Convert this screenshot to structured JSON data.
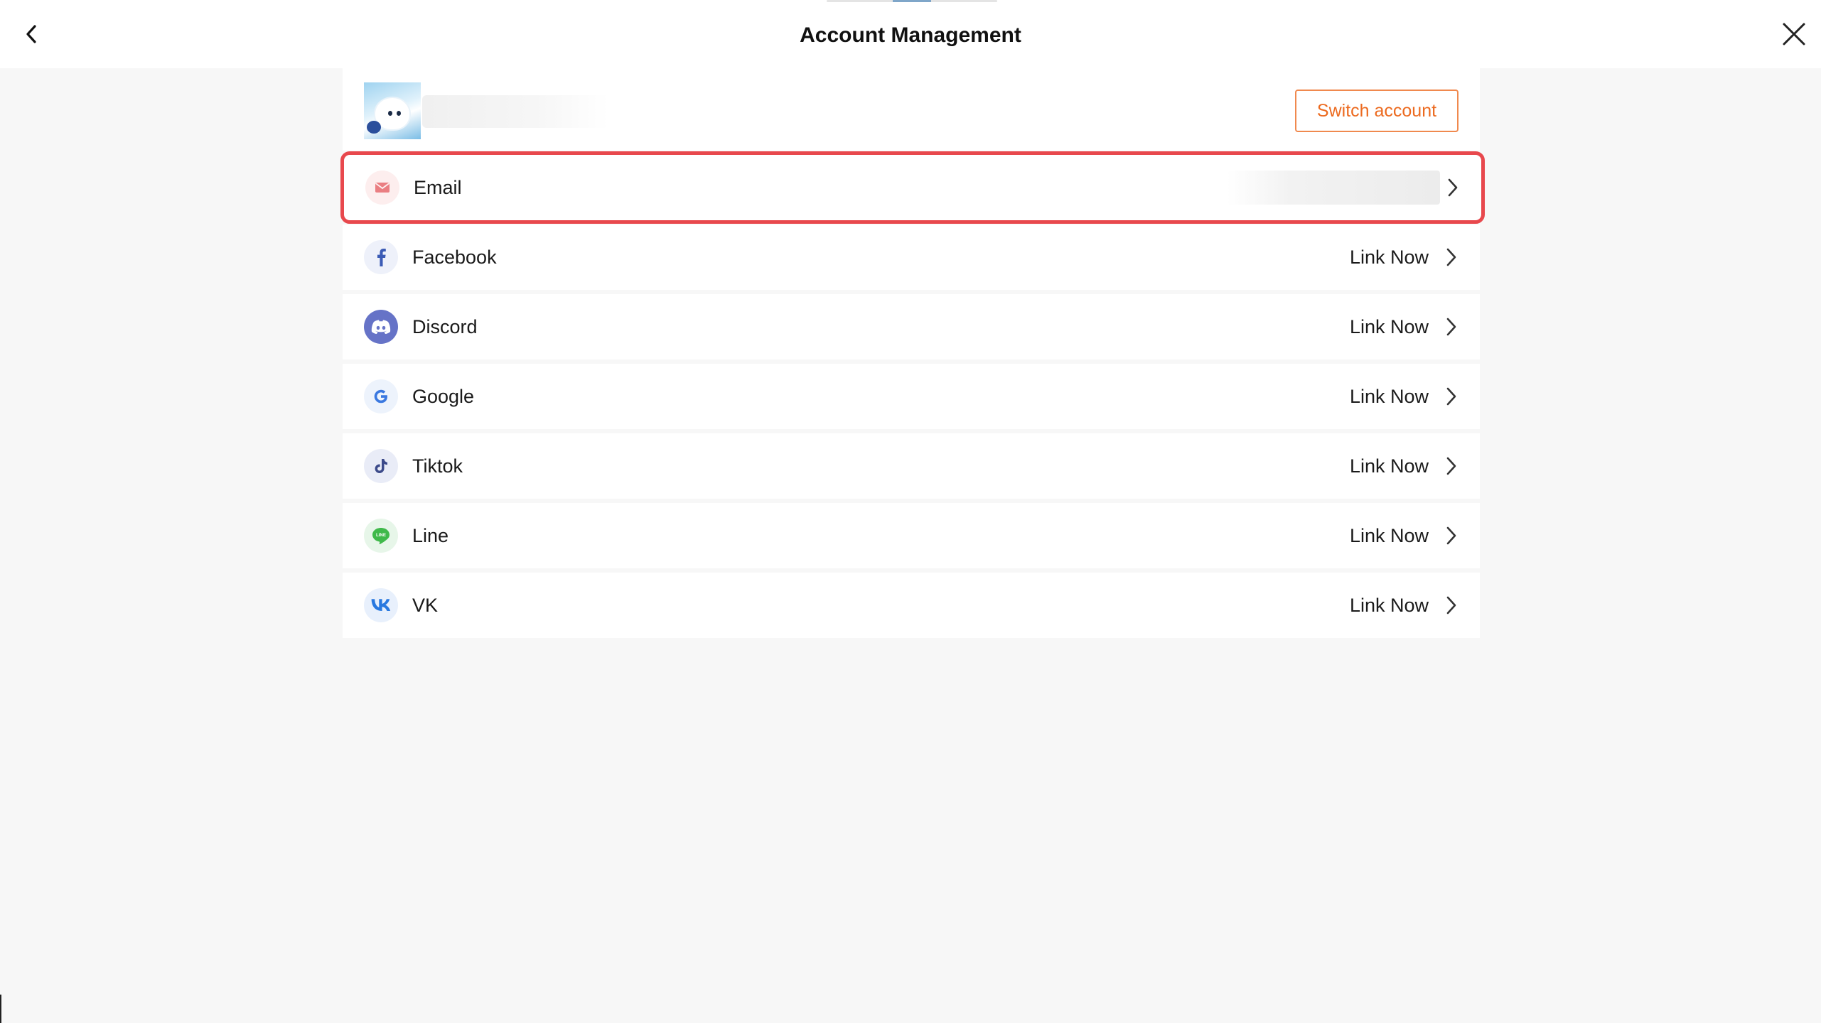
{
  "header": {
    "title": "Account Management",
    "back_icon": "chevron-left-icon",
    "close_icon": "close-icon"
  },
  "profile": {
    "switch_label": "Switch account"
  },
  "accounts": [
    {
      "label": "Email",
      "status": "",
      "icon": "mail-icon",
      "icon_color": "#e8646a",
      "icon_bg": "#fdeeee"
    },
    {
      "label": "Facebook",
      "status": "Link Now",
      "icon": "facebook-icon",
      "icon_color": "#3b5bb5",
      "icon_bg": "#eef1fa"
    },
    {
      "label": "Discord",
      "status": "Link Now",
      "icon": "discord-icon",
      "icon_color": "#ffffff",
      "icon_bg": "#6673c7"
    },
    {
      "label": "Google",
      "status": "Link Now",
      "icon": "google-icon",
      "icon_color": "#3a78e0",
      "icon_bg": "#edf3fc"
    },
    {
      "label": "Tiktok",
      "status": "Link Now",
      "icon": "tiktok-icon",
      "icon_color": "#3c4a8a",
      "icon_bg": "#e9ecf7"
    },
    {
      "label": "Line",
      "status": "Link Now",
      "icon": "line-icon",
      "icon_color": "#3fb94a",
      "icon_bg": "#e7f6e9"
    },
    {
      "label": "VK",
      "status": "Link Now",
      "icon": "vk-icon",
      "icon_color": "#2979e0",
      "icon_bg": "#e8f0fc"
    }
  ],
  "colors": {
    "accent": "#ec6a1f",
    "highlight": "#e8484d"
  }
}
